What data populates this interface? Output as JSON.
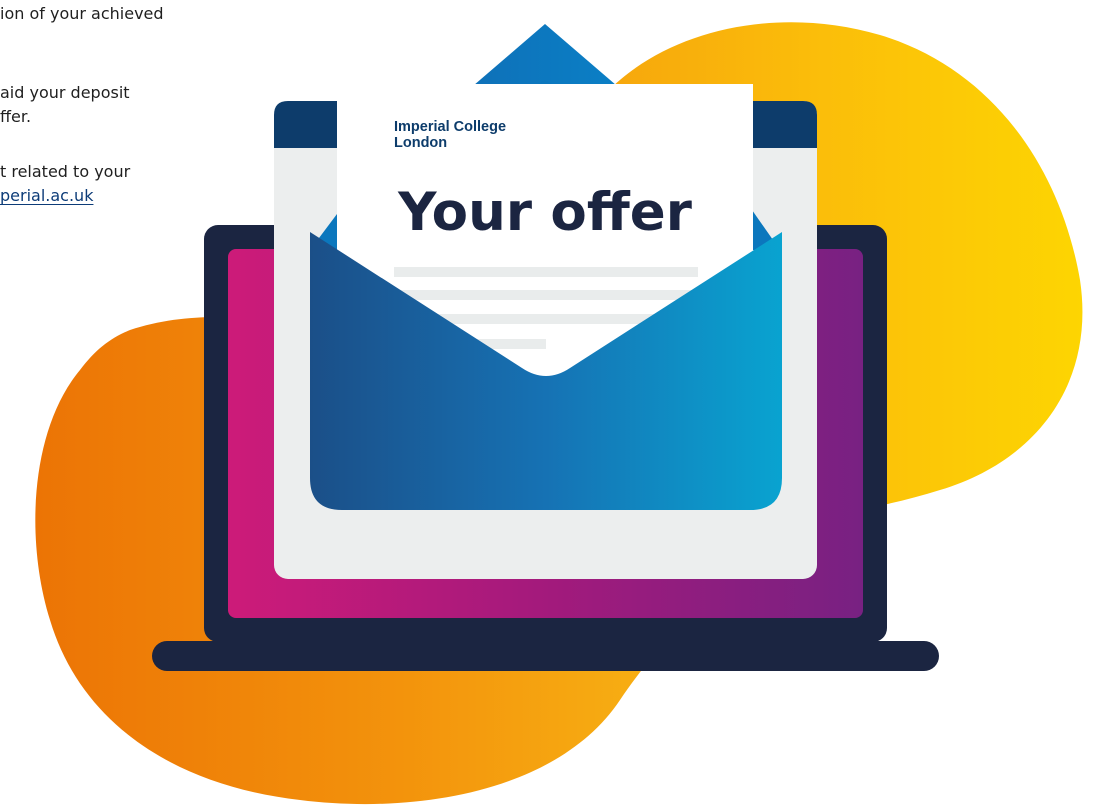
{
  "intro_text": {
    "line1": "ion of your achieved",
    "line2": "aid your deposit",
    "line3": "ffer.",
    "line4": "t related to your",
    "link": "perial.ac.uk"
  },
  "letter": {
    "brand_line1": "Imperial College",
    "brand_line2": "London",
    "heading": "Your offer"
  },
  "colors": {
    "orange_blob": "#ee7b0b",
    "yellow_blob": "#fcd006",
    "laptop_frame": "#1b2541",
    "screen_pink": "#c8197a",
    "screen_purple": "#7a2182",
    "envelope_dark_blue": "#1c4f87",
    "envelope_light_blue": "#0aa3cf",
    "window_header": "#0d3c6b",
    "paper": "#ffffff",
    "placeholder_lines": "#e9ecec"
  }
}
